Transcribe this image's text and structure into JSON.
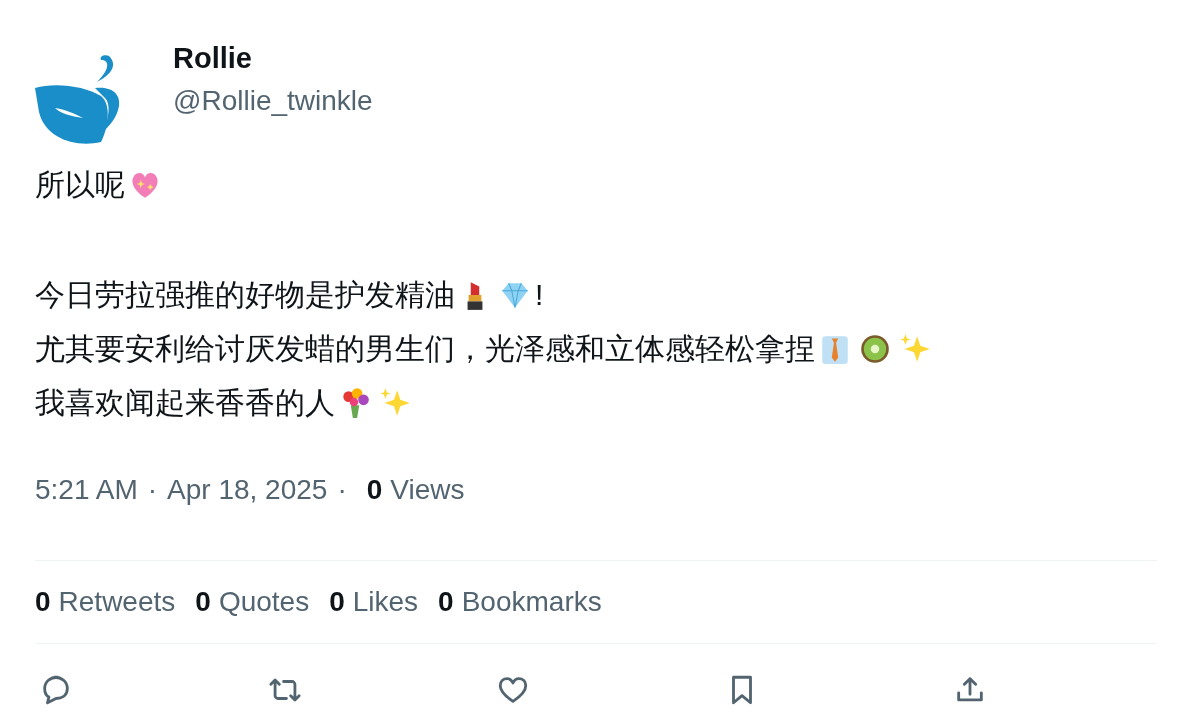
{
  "author": {
    "name": "Rollie",
    "handle": "@Rollie_twinkle"
  },
  "paragraphs": [
    [
      [
        {
          "kind": "text",
          "text": "所以呢"
        },
        {
          "kind": "emoji"
        }
      ]
    ],
    [
      [
        {
          "kind": "text",
          "text": "今日劳拉强推的好物是护发精油"
        },
        {
          "kind": "emoji"
        },
        {
          "kind": "emoji"
        },
        {
          "kind": "text",
          "text": "!"
        }
      ],
      [
        {
          "kind": "text",
          "text": "尤其要安利给讨厌发蜡的男生们，光泽感和立体感轻松拿捏"
        },
        {
          "kind": "emoji"
        },
        {
          "kind": "emoji"
        },
        {
          "kind": "emoji"
        }
      ],
      [
        {
          "kind": "text",
          "text": "我喜欢闻起来香香的人"
        },
        {
          "kind": "emoji"
        },
        {
          "kind": "emoji"
        }
      ]
    ]
  ],
  "meta": {
    "time": "5:21 AM",
    "separator_1": "·",
    "date": "Apr 18, 2025",
    "separator_2": "·",
    "views_count": "0",
    "views_label": "Views"
  },
  "stats": [
    {
      "count": "0",
      "label": "Retweets"
    },
    {
      "count": "0",
      "label": "Quotes"
    },
    {
      "count": "0",
      "label": "Likes"
    },
    {
      "count": "0",
      "label": "Bookmarks"
    }
  ],
  "actions": [
    {
      "kind": "reply"
    },
    {
      "kind": "retweet"
    },
    {
      "kind": "like"
    },
    {
      "kind": "bookmark"
    },
    {
      "kind": "share"
    }
  ]
}
